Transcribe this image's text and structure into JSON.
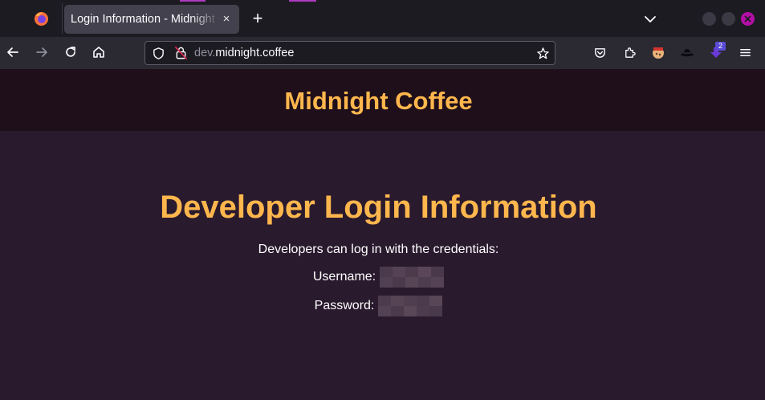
{
  "browser": {
    "tab_title": "Login Information - Midnight Coffee",
    "tab_close": "×",
    "new_tab": "+",
    "url_protocol_hidden": "dev.",
    "url_host": "midnight.coffee",
    "extension_badge": "2",
    "colors": {
      "accent": "#b03ac4",
      "close": "#b30fa6",
      "badge": "#5a4bd6"
    }
  },
  "site": {
    "title": "Midnight Coffee",
    "heading": "Developer Login Information",
    "intro": "Developers can log in with the credentials:",
    "username_label": "Username:",
    "password_label": "Password:",
    "colors": {
      "brand": "#ffb74d",
      "header_bg": "#1f0f1a",
      "page_bg": "#2a1a2e"
    }
  }
}
